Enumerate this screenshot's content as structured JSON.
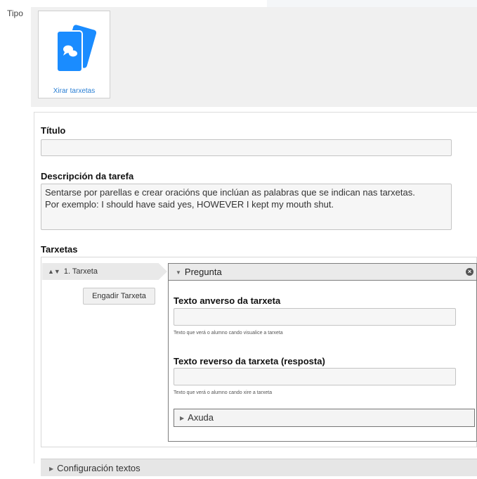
{
  "type_section": {
    "label": "Tipo",
    "tile_label": "Xirar tarxetas",
    "tile_icon": "flip-cards-icon",
    "accent_color": "#1a8cff"
  },
  "form": {
    "title_label": "Título",
    "title_value": "",
    "description_label": "Descripción da tarefa",
    "description_value": "Sentarse por parellas e crear oracións que inclúan as palabras que se indican nas tarxetas.\nPor exemplo: I should have said yes, HOWEVER I kept my mouth shut.",
    "cards_label": "Tarxetas"
  },
  "cards": {
    "items": [
      {
        "label": "1. Tarxeta"
      }
    ],
    "add_button": "Engadir Tarxeta"
  },
  "question": {
    "header": "Pregunta",
    "front_label": "Texto anverso da tarxeta",
    "front_value": "",
    "front_hint": "Texto que verá o alumno cando visualice a tarxeta",
    "back_label": "Texto reverso da tarxeta (resposta)",
    "back_value": "",
    "back_hint": "Texto que verá o alumno cando xire a tarxeta",
    "help_label": "Axuda"
  },
  "config": {
    "label": "Configuración textos"
  }
}
